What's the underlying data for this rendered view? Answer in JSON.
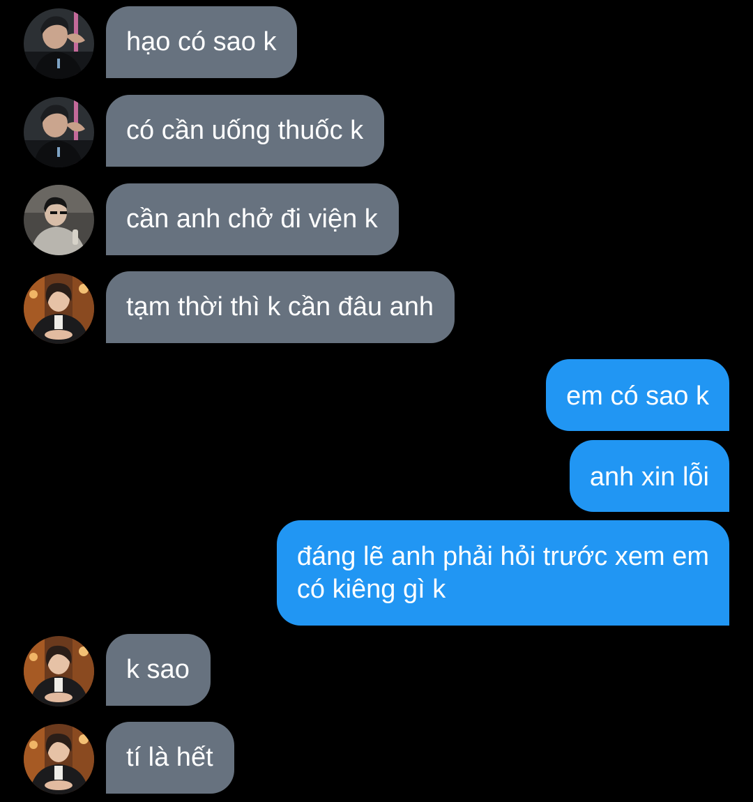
{
  "conversation": {
    "incoming_color": "#67727f",
    "outgoing_color": "#2196f3",
    "background": "#000000",
    "messages": [
      {
        "side": "incoming",
        "text": "hạo có sao k",
        "avatar": "avatar-dark-shirt-icon"
      },
      {
        "side": "incoming",
        "text": "có cần uống thuốc k",
        "avatar": "avatar-dark-shirt-icon"
      },
      {
        "side": "incoming",
        "text": "cần anh chở đi viện k",
        "avatar": "avatar-grey-jacket-icon"
      },
      {
        "side": "incoming",
        "text": "tạm thời thì k cần đâu anh",
        "avatar": "avatar-warm-room-icon"
      },
      {
        "side": "outgoing",
        "text": "em có sao k"
      },
      {
        "side": "outgoing",
        "text": "anh xin lỗi"
      },
      {
        "side": "outgoing",
        "text": "đáng lẽ anh phải hỏi trước xem em\ncó kiêng gì k"
      },
      {
        "side": "incoming",
        "text": "k sao",
        "avatar": "avatar-warm-room-icon"
      },
      {
        "side": "incoming",
        "text": "tí là hết",
        "avatar": "avatar-warm-room-icon"
      }
    ]
  }
}
